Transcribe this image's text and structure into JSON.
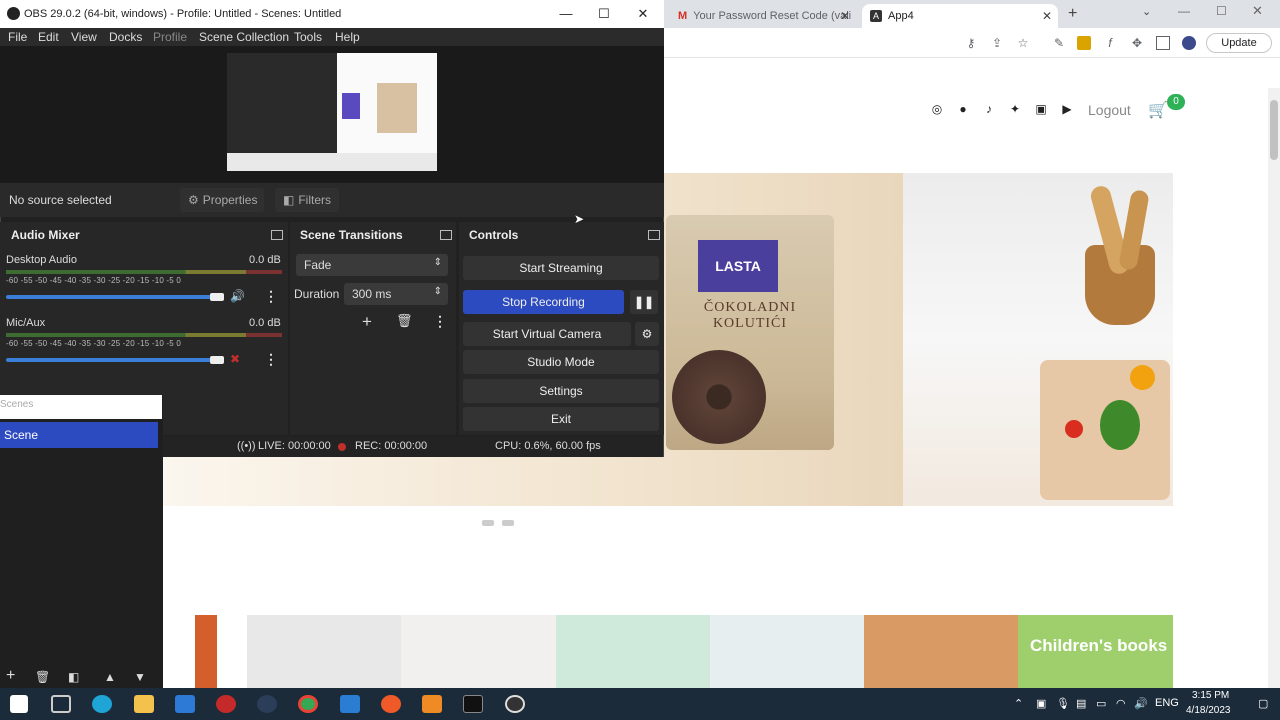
{
  "browser": {
    "tabs": [
      {
        "label": "Your Password Reset Code (vali"
      },
      {
        "label": "App4"
      }
    ],
    "update_label": "Update",
    "site": {
      "logout_label": "Logout",
      "cart_count": "0",
      "product_text": "ČOKOLADNI KOLUTIĆI",
      "brand": "LASTA",
      "category_tile": "Children's books"
    }
  },
  "obs": {
    "title": "OBS 29.0.2 (64-bit, windows) - Profile: Untitled - Scenes: Untitled",
    "menu": [
      "File",
      "Edit",
      "View",
      "Docks",
      "Profile",
      "Scene Collection",
      "Tools",
      "Help"
    ],
    "source_status": "No source selected",
    "properties_label": "Properties",
    "filters_label": "Filters",
    "audio_mixer": {
      "title": "Audio Mixer",
      "ticks": "-60 -55 -50 -45 -40 -35 -30 -25 -20 -15 -10 -5 0",
      "channels": [
        {
          "name": "Desktop Audio",
          "db": "0.0 dB"
        },
        {
          "name": "Mic/Aux",
          "db": "0.0 dB"
        }
      ]
    },
    "transitions": {
      "title": "Scene Transitions",
      "selected": "Fade",
      "duration_label": "Duration",
      "duration_value": "300 ms"
    },
    "controls": {
      "title": "Controls",
      "start_streaming": "Start Streaming",
      "stop_recording": "Stop Recording",
      "start_virtual_camera": "Start Virtual Camera",
      "studio_mode": "Studio Mode",
      "settings": "Settings",
      "exit": "Exit"
    },
    "scenes": {
      "title": "Scenes",
      "items": [
        "Scene"
      ]
    },
    "status": {
      "live": "LIVE: 00:00:00",
      "rec": "REC: 00:00:00",
      "cpu": "CPU: 0.6%, 60.00 fps"
    }
  },
  "taskbar": {
    "lang": "ENG",
    "time": "3:15 PM",
    "date": "4/18/2023"
  }
}
